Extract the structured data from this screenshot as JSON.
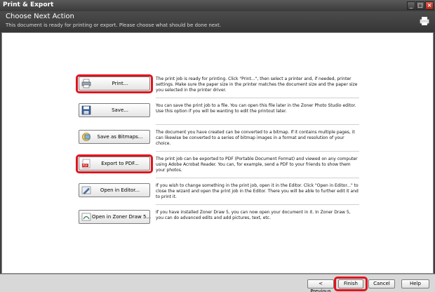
{
  "window": {
    "title": "Print & Export"
  },
  "header": {
    "title": "Choose Next Action",
    "subtitle": "This document is ready for printing or export. Please choose what should be done next."
  },
  "actions": [
    {
      "label": "Print...",
      "description": "The print job is ready for printing. Click \"Print...\", then select a printer and, if needed, printer settings. Make sure the paper size in the printer matches the document size and the paper size you selected in the printer driver."
    },
    {
      "label": "Save...",
      "description": "You can save the print job to a file. You can open this file later in the Zoner Photo Studio editor. Use this option if you will be wanting to edit the printout later."
    },
    {
      "label": "Save as Bitmaps...",
      "description": "The document you have created can be converted to a bitmap. If it contains multiple pages, it can likewise be converted to a series of bitmap images in a format and resolution of your choice."
    },
    {
      "label": "Export to PDF...",
      "description": "The print job can be exported to PDF (Portable Document Format) and viewed on any computer using Adobe Acrobat Reader. You can, for example, send a PDF to your friends to show them your photos."
    },
    {
      "label": "Open in Editor...",
      "description": "If you wish to change something in the print job, open it in the Editor. Click \"Open in Editor...\" to close the wizard and open the print job in the Editor. There you will be able to further edit it and to print it."
    },
    {
      "label": "Open in Zoner Draw 5...",
      "description": "If you have installed Zoner Draw 5, you can now open your document in it. In Zoner Draw 5, you can do advanced edits and add pictures, text, etc."
    }
  ],
  "footer": {
    "previous": "< Previous",
    "finish": "Finish",
    "cancel": "Cancel",
    "help": "Help"
  },
  "colors": {
    "highlight": "#e0141e",
    "header_bg": "#3f3f3f",
    "content_bg": "#ffffff"
  },
  "icons": [
    "printer-icon",
    "floppy-disk-icon",
    "bitmap-export-icon",
    "pdf-icon",
    "editor-icon",
    "zoner-draw-icon"
  ]
}
